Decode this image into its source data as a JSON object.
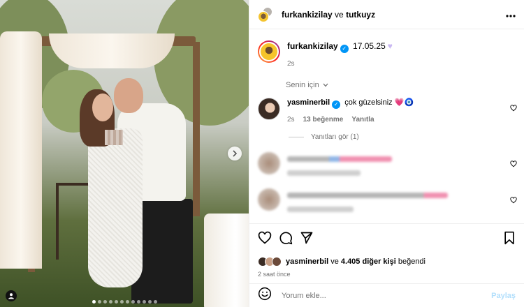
{
  "header": {
    "user1": "furkankizilay",
    "connector": "ve",
    "user2": "tutkuyz",
    "more_icon": "more-horizontal-icon"
  },
  "caption": {
    "username": "furkankizilay",
    "text": "17.05.25",
    "time": "2s"
  },
  "filter_label": "Senin için",
  "comments": [
    {
      "username": "yasminerbil",
      "text": "çok güzelsiniz",
      "emoji": "💗🧿",
      "time": "2s",
      "likes": "13 beğenme",
      "reply": "Yanıtla"
    }
  ],
  "view_replies": "Yanıtları gör (1)",
  "likes_line": {
    "user": "yasminerbil",
    "connector": "ve",
    "others": "4.405 diğer kişi",
    "suffix": "beğendi"
  },
  "time_ago": "2 saat önce",
  "comment_input": {
    "placeholder": "Yorum ekle...",
    "post_label": "Paylaş"
  },
  "colors": {
    "accent": "#0095f6",
    "muted": "#737373",
    "post_disabled": "#b2dffc"
  }
}
